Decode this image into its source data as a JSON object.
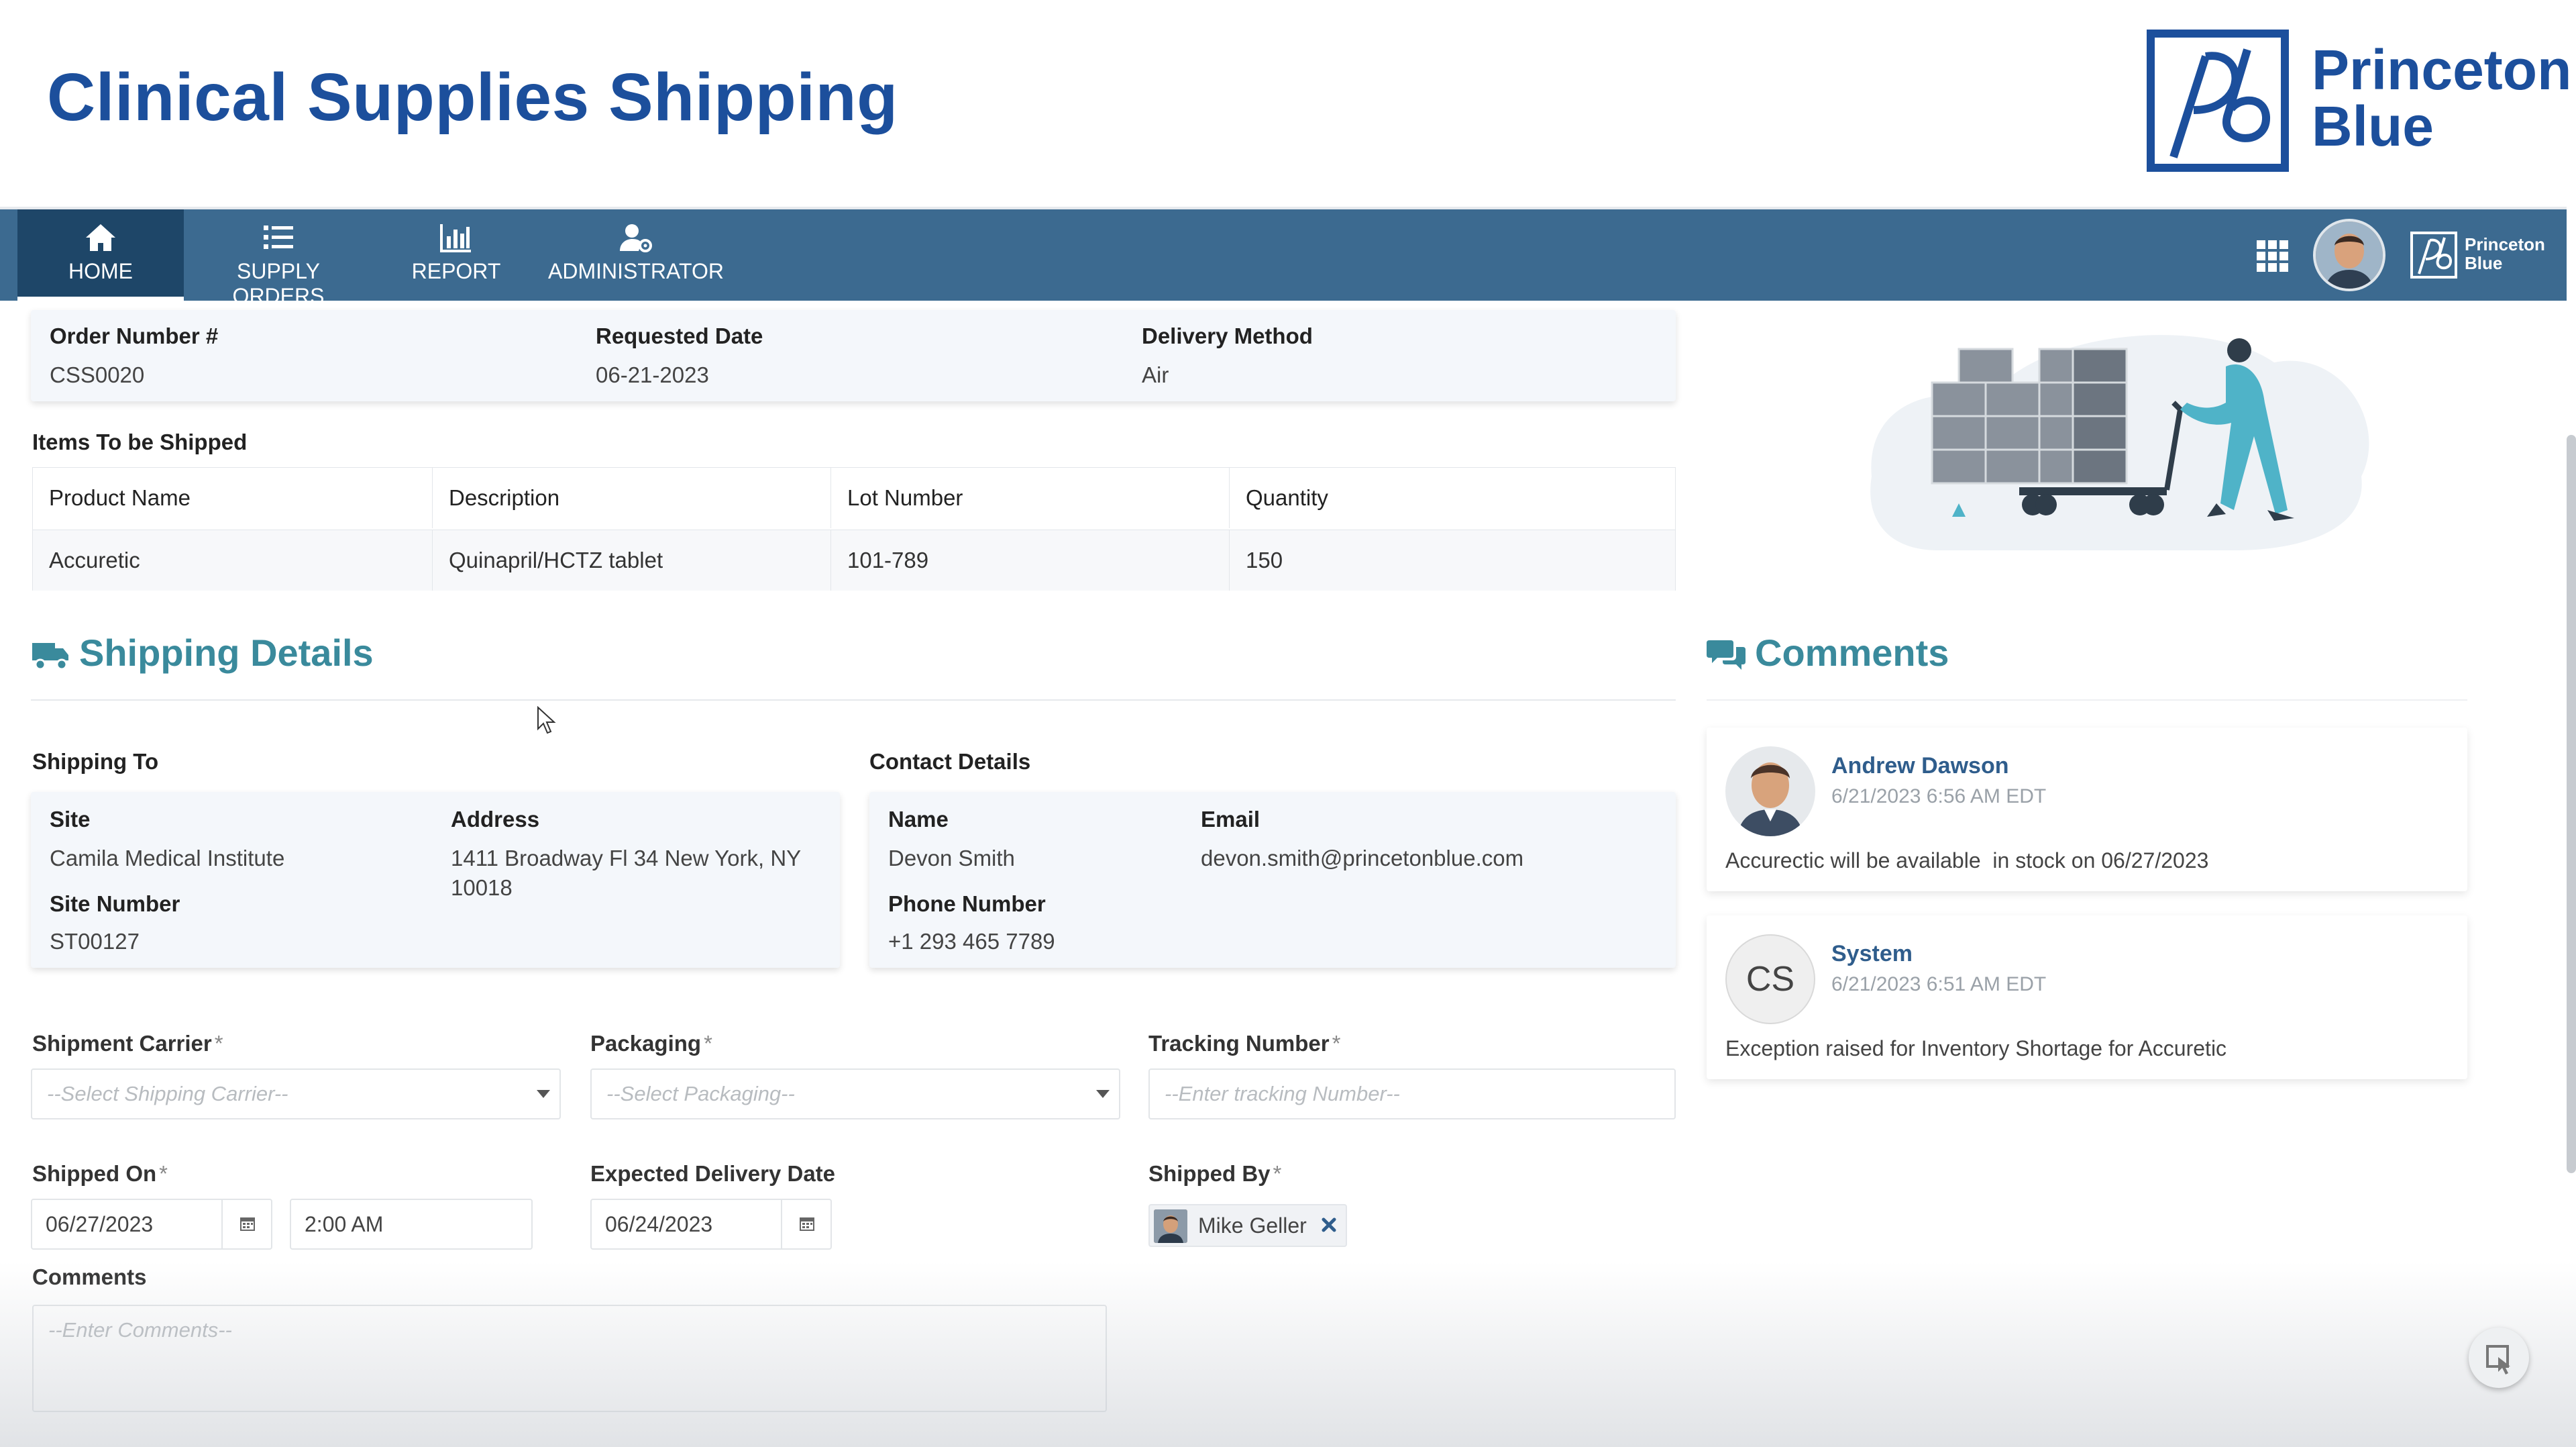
{
  "header": {
    "title": "Clinical Supplies Shipping",
    "brand_name_line1": "Princeton",
    "brand_name_line2": "Blue"
  },
  "nav": {
    "items": [
      {
        "label": "HOME",
        "icon": "home-icon",
        "active": true
      },
      {
        "label": "SUPPLY ORDERS",
        "icon": "list-icon"
      },
      {
        "label": "REPORT",
        "icon": "bar-chart-icon"
      },
      {
        "label": "ADMINISTRATOR",
        "icon": "user-cog-icon"
      }
    ],
    "brand_line1": "Princeton",
    "brand_line2": "Blue",
    "accent_color": "#3c6a90",
    "active_color": "#1e4668"
  },
  "order": {
    "number_label": "Order Number #",
    "number": "CSS0020",
    "requested_label": "Requested Date",
    "requested": "06-21-2023",
    "delivery_label": "Delivery Method",
    "delivery": "Air"
  },
  "items": {
    "heading": "Items To be Shipped",
    "columns": [
      "Product Name",
      "Description",
      "Lot Number",
      "Quantity"
    ],
    "rows": [
      [
        "Accuretic",
        "Quinapril/HCTZ tablet",
        "101-789",
        "150"
      ]
    ]
  },
  "shipping": {
    "title": "Shipping Details",
    "shipto_heading": "Shipping To",
    "site_label": "Site",
    "site": "Camila Medical Institute",
    "address_label": "Address",
    "address_line1": "1411 Broadway Fl 34 New York, NY",
    "address_line2": "10018",
    "site_number_label": "Site Number",
    "site_number": "ST00127",
    "contact_heading": "Contact Details",
    "name_label": "Name",
    "name": "Devon Smith",
    "email_label": "Email",
    "email": "devon.smith@princetonblue.com",
    "phone_label": "Phone Number",
    "phone": "+1 293 465 7789"
  },
  "form": {
    "carrier_label": "Shipment Carrier",
    "carrier_placeholder": "--Select Shipping Carrier--",
    "packaging_label": "Packaging",
    "packaging_placeholder": "--Select Packaging--",
    "tracking_label": "Tracking Number",
    "tracking_placeholder": "--Enter tracking Number--",
    "shipped_on_label": "Shipped On",
    "shipped_on_date": "06/27/2023",
    "shipped_on_time": "2:00 AM",
    "expected_label": "Expected Delivery Date",
    "expected_date": "06/24/2023",
    "shipped_by_label": "Shipped By",
    "shipped_by": "Mike Geller",
    "comments_label": "Comments",
    "comments_placeholder": "--Enter Comments--",
    "required_mark": "*"
  },
  "comments": {
    "title": "Comments",
    "entries": [
      {
        "author": "Andrew Dawson",
        "time": "6/21/2023 6:56 AM EDT",
        "text": "Accurectic will be available  in stock on 06/27/2023"
      },
      {
        "author": "System",
        "initials": "CS",
        "time": "6/21/2023 6:51 AM EDT",
        "text": "Exception raised for Inventory Shortage for Accuretic"
      }
    ]
  },
  "colors": {
    "title_blue": "#1c4f9c",
    "section_teal": "#3a8a9c",
    "link_blue": "#2f5d8c"
  }
}
